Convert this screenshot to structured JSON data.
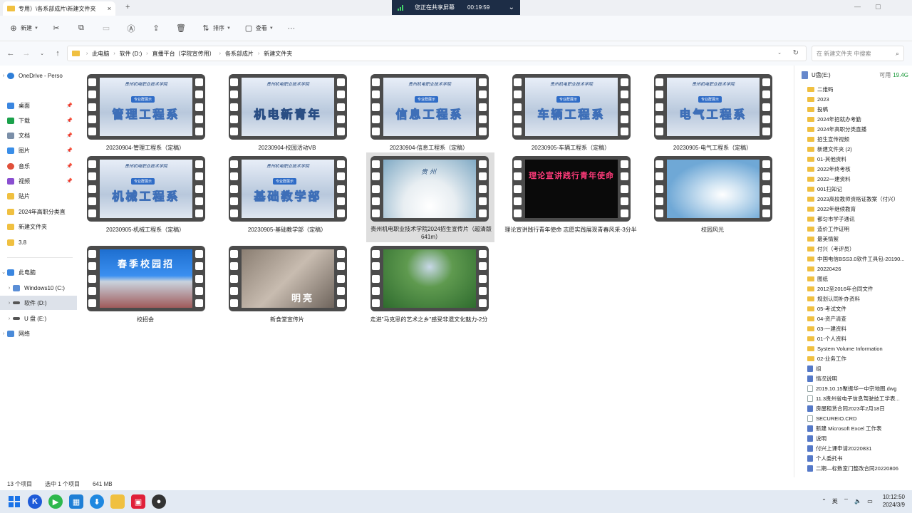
{
  "titlebar": {
    "tab_title": "专用）\\各系部成片\\新建文件夹",
    "close": "×",
    "new_tab": "+",
    "share_text": "您正在共享屏幕",
    "share_timer": "00:19:59",
    "share_chevron": "⌄",
    "minimize": "—",
    "maximize": "▢"
  },
  "toolbar": {
    "new_label": "新建",
    "sort_label": "排序",
    "view_label": "查看",
    "more": "···"
  },
  "address": {
    "crumbs": [
      "此电脑",
      "软件 (D:)",
      "直播平台（学院宣传用）",
      "各系部成片",
      "新建文件夹"
    ],
    "search_placeholder": "在 新建文件夹 中搜索"
  },
  "nav": {
    "onedrive": "OneDrive - Perso",
    "quick": [
      "桌面",
      "下载",
      "文档",
      "图片",
      "音乐",
      "视频",
      "贴片",
      "2024年高职分类直",
      "新建文件夹",
      "3.8"
    ],
    "thispc": "此电脑",
    "drives": [
      "Windows10 (C:)",
      "软件 (D:)",
      "U 盘 (E:)"
    ],
    "network": "网络"
  },
  "files": [
    {
      "name": "20230904-管理工程系（定稿）",
      "frame_text": "管理工程系"
    },
    {
      "name": "20230904-校园活动VB",
      "frame_text": "机电新青年"
    },
    {
      "name": "20230904-信息工程系（定稿）",
      "frame_text": "信息工程系"
    },
    {
      "name": "20230905-车辆工程系（定稿）",
      "frame_text": "车辆工程系"
    },
    {
      "name": "20230905-电气工程系（定稿）",
      "frame_text": "电气工程系"
    },
    {
      "name": "20230905-机械工程系（定稿）",
      "frame_text": "机械工程系"
    },
    {
      "name": "20230905-基础教学部（定稿）",
      "frame_text": "基础教学部"
    },
    {
      "name": "贵州机电职业技术学院2024招生宣传片（超清版641m）",
      "frame_text": "贵州"
    },
    {
      "name": "理论宣讲践行青年使命 志愿实践展现青春风采-3分半",
      "frame_text": "理论宣讲践行青年使命"
    },
    {
      "name": "校园风光",
      "frame_text": ""
    },
    {
      "name": "校招会",
      "frame_text": "春季校园招"
    },
    {
      "name": "新食堂宣传片",
      "frame_text": "明亮"
    },
    {
      "name": "走进\"马克思的艺术之乡\"感受非遗文化魅力-2分",
      "frame_text": ""
    }
  ],
  "preview": {
    "drive_label": "U盘(E:)",
    "avail_label": "可用",
    "avail_value": "19.4G",
    "items": [
      {
        "name": "二维码",
        "type": "folder"
      },
      {
        "name": "2023",
        "type": "folder"
      },
      {
        "name": "投稿",
        "type": "folder"
      },
      {
        "name": "2024年招就办考勤",
        "type": "folder"
      },
      {
        "name": "2024年高职分类直播",
        "type": "folder"
      },
      {
        "name": "招生宣传视频",
        "type": "folder"
      },
      {
        "name": "新建文件夹 (2)",
        "type": "folder"
      },
      {
        "name": "01-其他资料",
        "type": "folder"
      },
      {
        "name": "2022年终考核",
        "type": "folder"
      },
      {
        "name": "2022一建资料",
        "type": "folder"
      },
      {
        "name": "001扫知记",
        "type": "folder"
      },
      {
        "name": "2023高校教师资格证教案（付兴）",
        "type": "folder"
      },
      {
        "name": "2022年继续教育",
        "type": "folder"
      },
      {
        "name": "都匀市学子通讯",
        "type": "folder"
      },
      {
        "name": "造价工作证明",
        "type": "folder"
      },
      {
        "name": "最美情絮",
        "type": "folder"
      },
      {
        "name": "付兴（考评员）",
        "type": "folder"
      },
      {
        "name": "中国电信BSS3.0软件工具包-20190...",
        "type": "folder"
      },
      {
        "name": "20220426",
        "type": "folder"
      },
      {
        "name": "图纸",
        "type": "folder"
      },
      {
        "name": "2012至2016年合同文件",
        "type": "folder"
      },
      {
        "name": "规划认同补办资料",
        "type": "folder"
      },
      {
        "name": "05-考试文件",
        "type": "folder"
      },
      {
        "name": "04-资产清查",
        "type": "folder"
      },
      {
        "name": "03-一建资料",
        "type": "folder"
      },
      {
        "name": "01-个人资料",
        "type": "folder"
      },
      {
        "name": "System Volume Information",
        "type": "folder"
      },
      {
        "name": "02-业务工作",
        "type": "folder"
      },
      {
        "name": "组",
        "type": "doc"
      },
      {
        "name": "情况说明",
        "type": "doc"
      },
      {
        "name": "2019.10.15聚振华一中宗地图.dwg",
        "type": "blank"
      },
      {
        "name": "11.3贵州省电子信息驾驶技工学表...",
        "type": "blank"
      },
      {
        "name": "房屋租赁合同2023年2月18日",
        "type": "doc"
      },
      {
        "name": "SECUREIO.CRD",
        "type": "blank"
      },
      {
        "name": "新建 Microsoft Excel 工作表",
        "type": "doc"
      },
      {
        "name": "说明",
        "type": "doc"
      },
      {
        "name": "付兴上课申请20220831",
        "type": "doc"
      },
      {
        "name": "个人委托书",
        "type": "doc"
      },
      {
        "name": "二期—标数室门整改合同20220806",
        "type": "doc"
      }
    ]
  },
  "status": {
    "count": "13 个项目",
    "selected": "选中 1 个项目",
    "size": "641 MB"
  },
  "taskbar": {
    "ime": "英",
    "time": "10:12:50",
    "date": "2024/3/9"
  }
}
